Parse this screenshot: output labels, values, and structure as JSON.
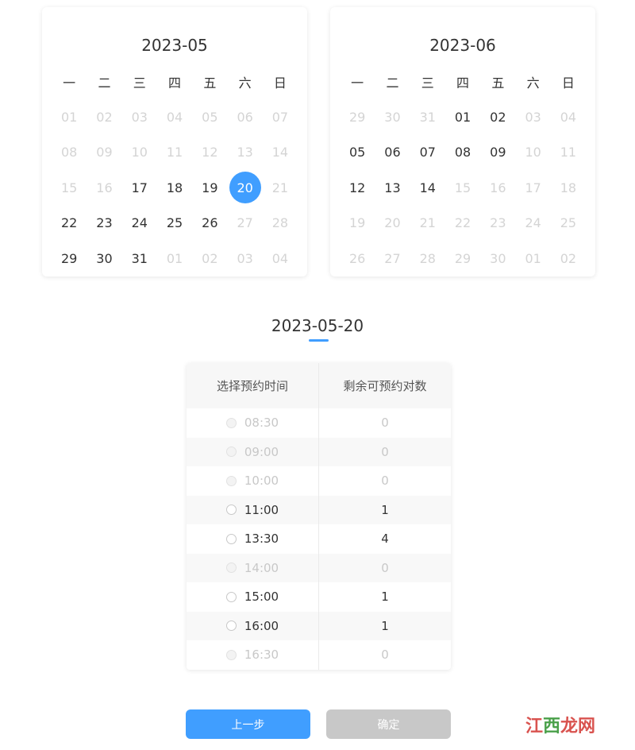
{
  "weekdays": [
    "一",
    "二",
    "三",
    "四",
    "五",
    "六",
    "日"
  ],
  "calendars": [
    {
      "title": "2023-05",
      "days": [
        {
          "d": "01",
          "s": "dis"
        },
        {
          "d": "02",
          "s": "dis"
        },
        {
          "d": "03",
          "s": "dis"
        },
        {
          "d": "04",
          "s": "dis"
        },
        {
          "d": "05",
          "s": "dis"
        },
        {
          "d": "06",
          "s": "dis"
        },
        {
          "d": "07",
          "s": "dis"
        },
        {
          "d": "08",
          "s": "dis"
        },
        {
          "d": "09",
          "s": "dis"
        },
        {
          "d": "10",
          "s": "dis"
        },
        {
          "d": "11",
          "s": "dis"
        },
        {
          "d": "12",
          "s": "dis"
        },
        {
          "d": "13",
          "s": "dis"
        },
        {
          "d": "14",
          "s": "dis"
        },
        {
          "d": "15",
          "s": "dis"
        },
        {
          "d": "16",
          "s": "dis"
        },
        {
          "d": "17",
          "s": "en"
        },
        {
          "d": "18",
          "s": "en"
        },
        {
          "d": "19",
          "s": "en"
        },
        {
          "d": "20",
          "s": "sel"
        },
        {
          "d": "21",
          "s": "dis"
        },
        {
          "d": "22",
          "s": "en"
        },
        {
          "d": "23",
          "s": "en"
        },
        {
          "d": "24",
          "s": "en"
        },
        {
          "d": "25",
          "s": "en"
        },
        {
          "d": "26",
          "s": "en"
        },
        {
          "d": "27",
          "s": "dis"
        },
        {
          "d": "28",
          "s": "dis"
        },
        {
          "d": "29",
          "s": "en"
        },
        {
          "d": "30",
          "s": "en"
        },
        {
          "d": "31",
          "s": "en"
        },
        {
          "d": "01",
          "s": "dis"
        },
        {
          "d": "02",
          "s": "dis"
        },
        {
          "d": "03",
          "s": "dis"
        },
        {
          "d": "04",
          "s": "dis"
        }
      ]
    },
    {
      "title": "2023-06",
      "days": [
        {
          "d": "29",
          "s": "dis"
        },
        {
          "d": "30",
          "s": "dis"
        },
        {
          "d": "31",
          "s": "dis"
        },
        {
          "d": "01",
          "s": "en"
        },
        {
          "d": "02",
          "s": "en"
        },
        {
          "d": "03",
          "s": "dis"
        },
        {
          "d": "04",
          "s": "dis"
        },
        {
          "d": "05",
          "s": "en"
        },
        {
          "d": "06",
          "s": "en"
        },
        {
          "d": "07",
          "s": "en"
        },
        {
          "d": "08",
          "s": "en"
        },
        {
          "d": "09",
          "s": "en"
        },
        {
          "d": "10",
          "s": "dis"
        },
        {
          "d": "11",
          "s": "dis"
        },
        {
          "d": "12",
          "s": "en"
        },
        {
          "d": "13",
          "s": "en"
        },
        {
          "d": "14",
          "s": "en"
        },
        {
          "d": "15",
          "s": "dis"
        },
        {
          "d": "16",
          "s": "dis"
        },
        {
          "d": "17",
          "s": "dis"
        },
        {
          "d": "18",
          "s": "dis"
        },
        {
          "d": "19",
          "s": "dis"
        },
        {
          "d": "20",
          "s": "dis"
        },
        {
          "d": "21",
          "s": "dis"
        },
        {
          "d": "22",
          "s": "dis"
        },
        {
          "d": "23",
          "s": "dis"
        },
        {
          "d": "24",
          "s": "dis"
        },
        {
          "d": "25",
          "s": "dis"
        },
        {
          "d": "26",
          "s": "dis"
        },
        {
          "d": "27",
          "s": "dis"
        },
        {
          "d": "28",
          "s": "dis"
        },
        {
          "d": "29",
          "s": "dis"
        },
        {
          "d": "30",
          "s": "dis"
        },
        {
          "d": "01",
          "s": "dis"
        },
        {
          "d": "02",
          "s": "dis"
        }
      ]
    }
  ],
  "selected_date": "2023-05-20",
  "table": {
    "headers": [
      "选择预约时间",
      "剩余可预约对数"
    ],
    "rows": [
      {
        "time": "08:30",
        "remaining": "0",
        "enabled": false
      },
      {
        "time": "09:00",
        "remaining": "0",
        "enabled": false
      },
      {
        "time": "10:00",
        "remaining": "0",
        "enabled": false
      },
      {
        "time": "11:00",
        "remaining": "1",
        "enabled": true
      },
      {
        "time": "13:30",
        "remaining": "4",
        "enabled": true
      },
      {
        "time": "14:00",
        "remaining": "0",
        "enabled": false
      },
      {
        "time": "15:00",
        "remaining": "1",
        "enabled": true
      },
      {
        "time": "16:00",
        "remaining": "1",
        "enabled": true
      },
      {
        "time": "16:30",
        "remaining": "0",
        "enabled": false
      }
    ]
  },
  "buttons": {
    "prev": "上一步",
    "confirm": "确定"
  },
  "watermark": {
    "part1": "江",
    "part2": "西",
    "part3": "龙网"
  },
  "colors": {
    "accent": "#409eff",
    "disabled_button": "#c8c8c8",
    "disabled_text": "#d4d4d4"
  }
}
